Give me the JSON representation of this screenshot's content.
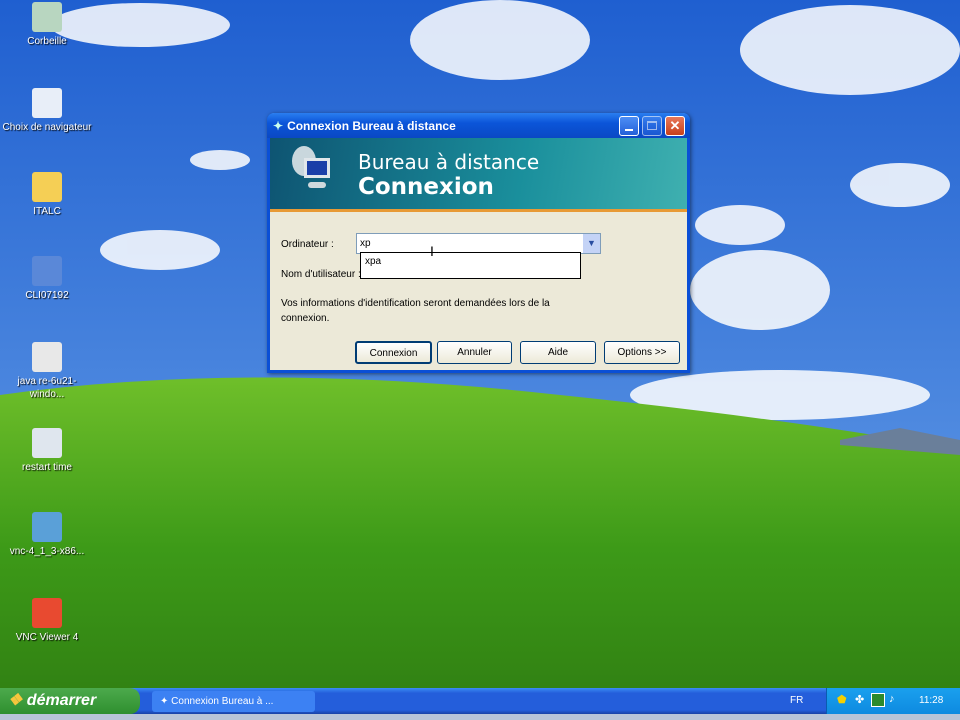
{
  "desktop": {
    "icons": [
      {
        "label": "Corbeille",
        "icon": "recycle-bin-icon"
      },
      {
        "label": "Choix de navigateur",
        "icon": "browser-choice-icon"
      },
      {
        "label": "ITALC",
        "icon": "folder-icon"
      },
      {
        "label": "CLI07192",
        "icon": "network-icon"
      },
      {
        "label": "java re-6u21-windo...",
        "icon": "java-icon"
      },
      {
        "label": "restart time",
        "icon": "script-icon"
      },
      {
        "label": "vnc-4_1_3-x86...",
        "icon": "installer-icon"
      },
      {
        "label": "VNC Viewer 4",
        "icon": "vnc-icon"
      }
    ]
  },
  "dialog": {
    "title": "Connexion Bureau à distance",
    "banner_line1": "Bureau à distance",
    "banner_line2": "Connexion",
    "computer_label": "Ordinateur :",
    "computer_value": "xp",
    "autocomplete": [
      "xpa"
    ],
    "user_label": "Nom d'utilisateur :",
    "info": "Vos informations d'identification seront demandées lors de la connexion.",
    "buttons": {
      "connect": "Connexion",
      "cancel": "Annuler",
      "help": "Aide",
      "options": "Options >>"
    }
  },
  "taskbar": {
    "start": "démarrer",
    "task": "Connexion Bureau à ...",
    "lang": "FR",
    "clock": "11:28"
  }
}
